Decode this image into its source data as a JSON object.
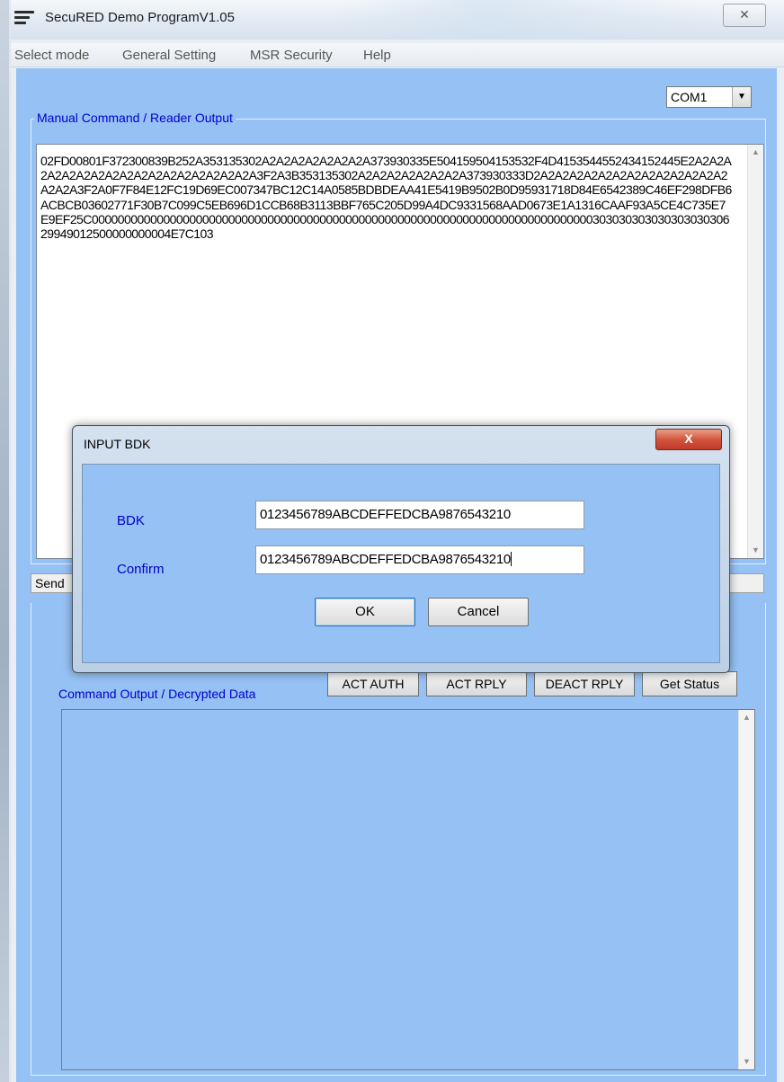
{
  "window": {
    "title": "SecuRED Demo ProgramV1.05",
    "close_glyph": "✕"
  },
  "menu": {
    "items": [
      "Select mode",
      "General Setting",
      "MSR Security",
      "Help"
    ]
  },
  "com_port": {
    "value": "COM1",
    "arrow": "▼"
  },
  "manual": {
    "group_label": "Manual Command / Reader Output",
    "output_text": "02FD00801F372300839B252A353135302A2A2A2A2A2A2A2A373930335E504159504153532F4D4153544552434152445E2A2A2A2A2A2A2A2A2A2A2A2A2A2A2A2A2A2A3F2A3B353135302A2A2A2A2A2A2A2A373930333D2A2A2A2A2A2A2A2A2A2A2A2A2A2A2A2A3F2A0F7F84E12FC19D69EC007347BC12C14A0585BDBDEAA41E5419B9502B0D95931718D84E6542389C46EF298DFB6ACBCB03602771F30B7C099C5EB696D1CCB68B3113BBF765C205D99A4DC9331568AAD0673E1A1316CAAF93A5CE4C735E7E9EF25C0000000000000000000000000000000000000000000000000000000000000000000000000000030303030303030303030629949012500000000004E7C103"
  },
  "send_strip": {
    "label": "Send"
  },
  "command": {
    "group_label": "Command Output / Decrypted Data",
    "buttons": [
      "ACT AUTH",
      "ACT RPLY",
      "DEACT RPLY",
      "Get Status"
    ]
  },
  "dialog": {
    "title": "INPUT BDK",
    "close_glyph": "X",
    "bdk_label": "BDK",
    "bdk_value": "0123456789ABCDEFFEDCBA9876543210",
    "confirm_label": "Confirm",
    "confirm_value": "0123456789ABCDEFFEDCBA9876543210",
    "ok_label": "OK",
    "cancel_label": "Cancel"
  },
  "scroll": {
    "up": "▲",
    "down": "▼"
  }
}
